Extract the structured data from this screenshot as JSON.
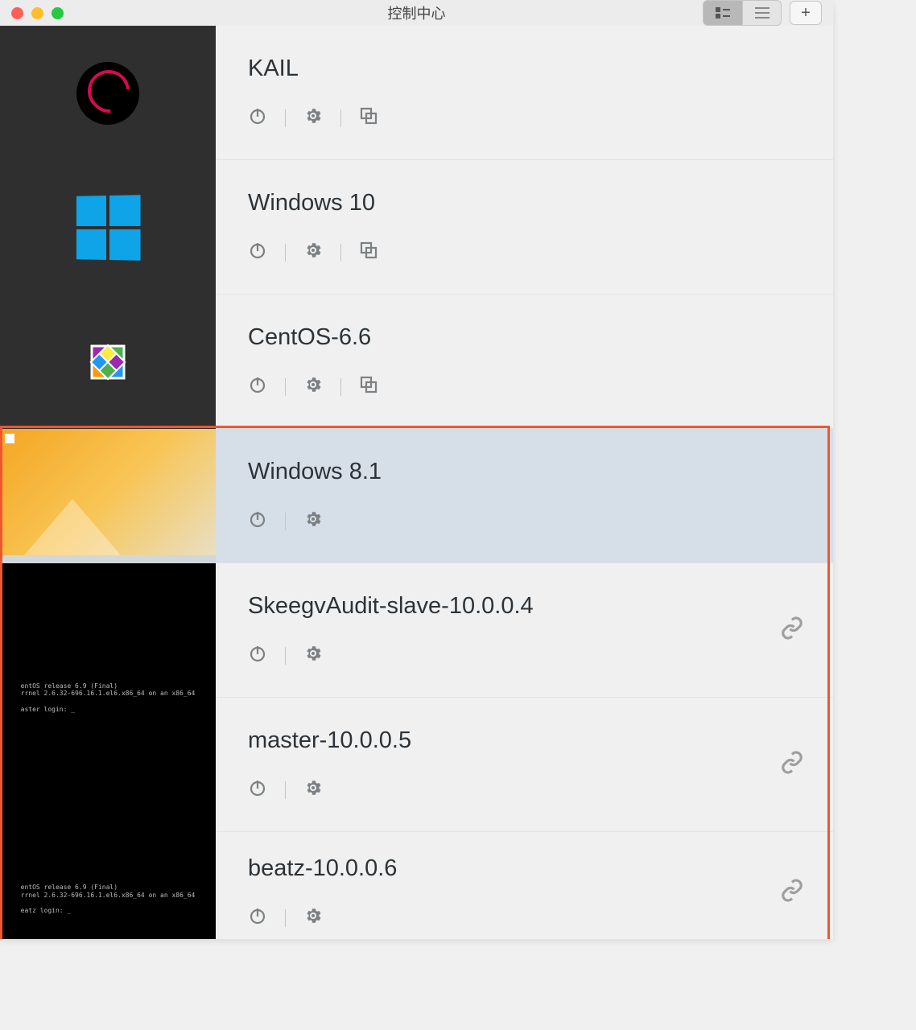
{
  "window": {
    "title": "控制中心"
  },
  "toolbar": {
    "view_tile": "tile",
    "view_list": "list",
    "add_label": "+"
  },
  "vms": [
    {
      "name": "KAIL",
      "os": "debian",
      "has_clone": true,
      "linked": false
    },
    {
      "name": "Windows 10",
      "os": "win10",
      "has_clone": true,
      "linked": false
    },
    {
      "name": "CentOS-6.6",
      "os": "centos",
      "has_clone": true,
      "linked": false
    },
    {
      "name": "Windows 8.1",
      "os": "win81",
      "has_clone": false,
      "linked": false,
      "selected": true,
      "thumb": "win81"
    },
    {
      "name": "SkeegvAudit-slave-10.0.0.4",
      "os": "centos-term",
      "has_clone": false,
      "linked": true,
      "thumb": "term"
    },
    {
      "name": "master-10.0.0.5",
      "os": "centos-term",
      "has_clone": false,
      "linked": true,
      "thumb": "term"
    },
    {
      "name": "beatz-10.0.0.6",
      "os": "centos-term",
      "has_clone": false,
      "linked": true,
      "thumb": "term"
    }
  ],
  "terminal_text_1": "entOS release 6.9 (Final)\nrrnel 2.6.32-696.16.1.el6.x86_64 on an x86_64\n\naster login: _",
  "terminal_text_2": "entOS release 6.9 (Final)\nrrnel 2.6.32-696.16.1.el6.x86_64 on an x86_64\n\neatz login: _",
  "colors": {
    "selected_bg": "#d6dee8",
    "highlight_border": "#ee572f",
    "action_icon": "#7d8083"
  }
}
